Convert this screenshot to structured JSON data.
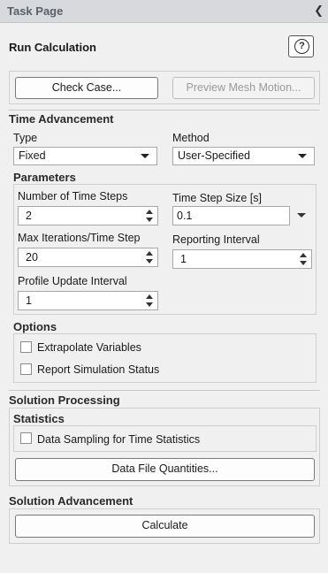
{
  "window": {
    "title": "Task Page",
    "collapse_icon": "chevron-left-icon"
  },
  "header": {
    "title": "Run Calculation",
    "help_icon": "help-icon",
    "help_glyph": "?"
  },
  "top_buttons": {
    "check_case": "Check Case...",
    "preview_mesh": "Preview Mesh Motion..."
  },
  "time_advancement": {
    "title": "Time Advancement",
    "type_label": "Type",
    "type_value": "Fixed",
    "method_label": "Method",
    "method_value": "User-Specified"
  },
  "parameters": {
    "title": "Parameters",
    "num_time_steps_label": "Number of Time Steps",
    "num_time_steps_value": "2",
    "time_step_size_label": "Time Step Size [s]",
    "time_step_size_value": "0.1",
    "max_iter_label": "Max Iterations/Time Step",
    "max_iter_value": "20",
    "reporting_interval_label": "Reporting Interval",
    "reporting_interval_value": "1",
    "profile_update_label": "Profile Update Interval",
    "profile_update_value": "1"
  },
  "options": {
    "title": "Options",
    "extrapolate_label": "Extrapolate Variables",
    "extrapolate_checked": false,
    "report_status_label": "Report Simulation Status",
    "report_status_checked": false
  },
  "solution_processing": {
    "title": "Solution Processing",
    "statistics_title": "Statistics",
    "data_sampling_label": "Data Sampling for Time Statistics",
    "data_sampling_checked": false,
    "data_file_button": "Data File Quantities..."
  },
  "solution_advancement": {
    "title": "Solution Advancement",
    "calculate_button": "Calculate"
  }
}
